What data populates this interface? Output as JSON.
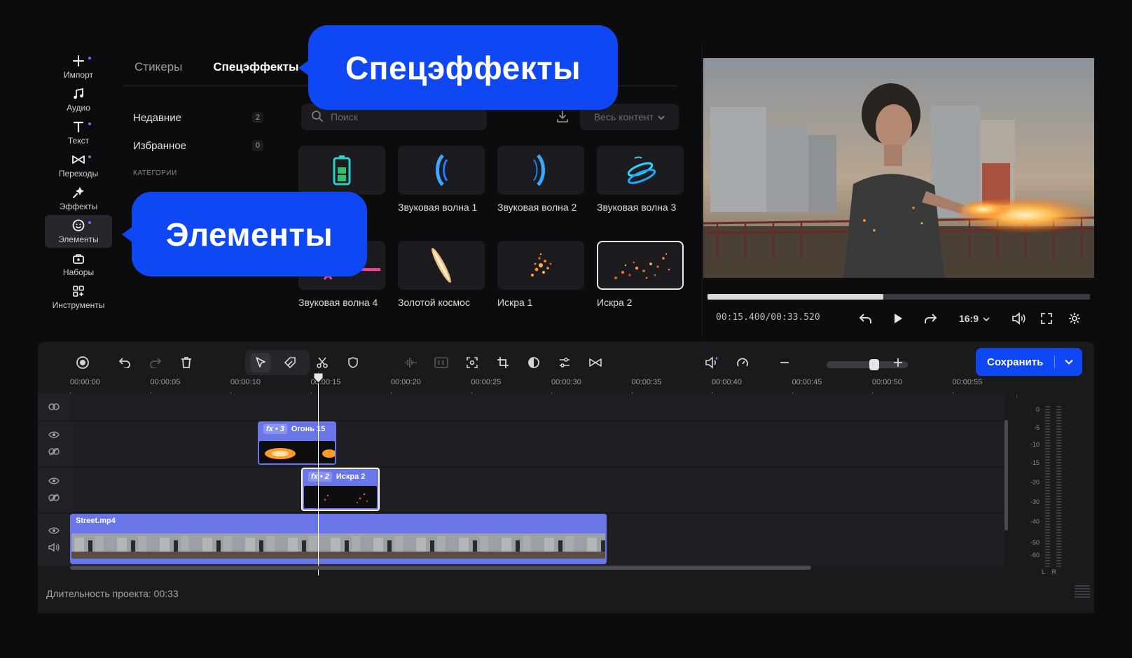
{
  "sidebar": {
    "items": [
      {
        "label": "Импорт",
        "icon": "plus-icon",
        "dot": true
      },
      {
        "label": "Аудио",
        "icon": "music-note-icon",
        "dot": false
      },
      {
        "label": "Текст",
        "icon": "text-t-icon",
        "dot": true
      },
      {
        "label": "Переходы",
        "icon": "transition-bowtie-icon",
        "dot": true
      },
      {
        "label": "Эффекты",
        "icon": "sparkle-effects-icon",
        "dot": false
      },
      {
        "label": "Элементы",
        "icon": "smiley-elements-icon",
        "dot": true,
        "active": true
      },
      {
        "label": "Наборы",
        "icon": "bag-sets-icon",
        "dot": false
      },
      {
        "label": "Инструменты",
        "icon": "grid-tools-icon",
        "dot": false
      }
    ]
  },
  "library": {
    "tabs": [
      "Стикеры",
      "Спецэффекты"
    ],
    "active_tab": "Спецэффекты",
    "recent_label": "Недавние",
    "recent_count": "2",
    "favorites_label": "Избранное",
    "favorites_count": "0",
    "categories_header": "КАТЕГОРИИ",
    "search_placeholder": "Поиск",
    "filter_label": "Весь контент",
    "items": [
      {
        "caption": "",
        "icon": "battery-icon"
      },
      {
        "caption": "Звуковая волна 1",
        "icon": "sound-wave-icon"
      },
      {
        "caption": "Звуковая волна 2",
        "icon": "sound-wave-icon"
      },
      {
        "caption": "Звуковая волна 3",
        "icon": "sound-wave-icon"
      },
      {
        "caption": "Звуковая волна 4",
        "icon": "sound-wave-icon"
      },
      {
        "caption": "Золотой космос",
        "icon": "golden-streak-icon"
      },
      {
        "caption": "Искра 1",
        "icon": "spark-icon"
      },
      {
        "caption": "Искра 2",
        "icon": "spark-icon",
        "selected": true
      }
    ]
  },
  "callouts": {
    "effects": "Спецэффекты",
    "elements": "Элементы"
  },
  "preview": {
    "progress_fraction": 0.46,
    "timecode": "00:15.400/00:33.520",
    "aspect_ratio": "16:9"
  },
  "timeline": {
    "save_label": "Сохранить",
    "zoom_fraction": 0.6,
    "ruler_labels": [
      "00:00:00",
      "00:00:05",
      "00:00:10",
      "00:00:15",
      "00:00:20",
      "00:00:25",
      "00:00:30",
      "00:00:35",
      "00:00:40",
      "00:00:45",
      "00:00:50",
      "00:00:55"
    ],
    "clips": {
      "fire": {
        "fx": "fx • 3",
        "name": "Огонь 15"
      },
      "spark": {
        "fx": "fx • 2",
        "name": "Искра 2"
      },
      "video": {
        "name": "Street.mp4"
      }
    },
    "meter_labels": [
      "0",
      "-5",
      "-10",
      "-15",
      "-20",
      "-30",
      "-40",
      "-50",
      "-60"
    ],
    "meter_channels": [
      "L",
      "R"
    ],
    "duration_text": "Длительность проекта: 00:33"
  },
  "colors": {
    "accent": "#1047f5",
    "clip": "#6a76e8",
    "background": "#0c0c0e",
    "panel": "#1a1a1d"
  }
}
